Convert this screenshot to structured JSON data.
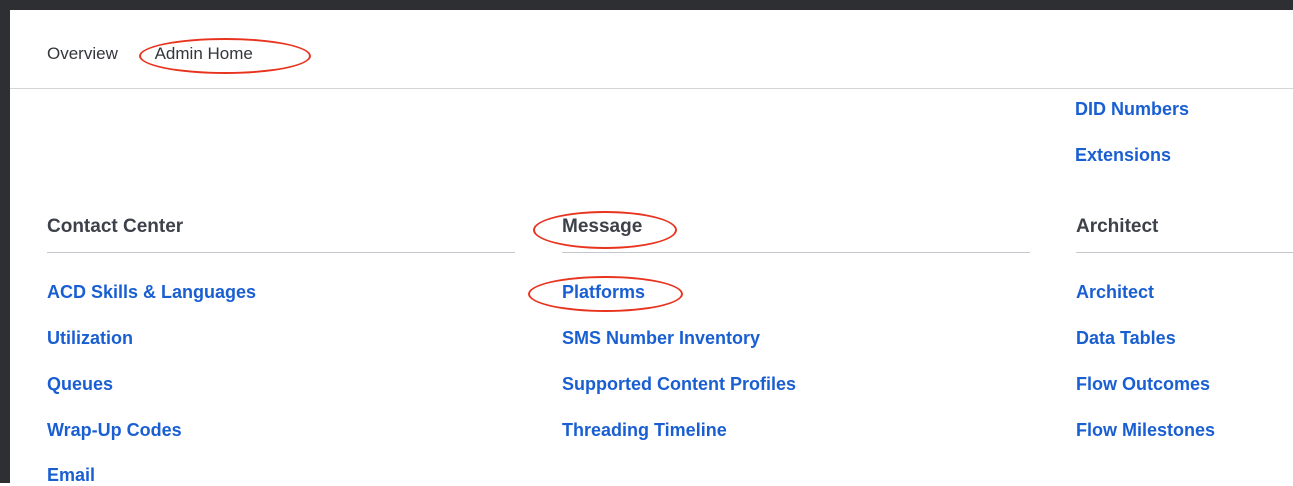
{
  "breadcrumb": {
    "items": [
      "Overview",
      "Admin Home"
    ]
  },
  "top_links": [
    "DID Numbers",
    "Extensions"
  ],
  "sections": [
    {
      "title": "Contact Center",
      "links": [
        "ACD Skills & Languages",
        "Utilization",
        "Queues",
        "Wrap-Up Codes",
        "Email"
      ]
    },
    {
      "title": "Message",
      "links": [
        "Platforms",
        "SMS Number Inventory",
        "Supported Content Profiles",
        "Threading Timeline"
      ]
    },
    {
      "title": "Architect",
      "links": [
        "Architect",
        "Data Tables",
        "Flow Outcomes",
        "Flow Milestones"
      ]
    }
  ],
  "colors": {
    "link": "#1a5fd2",
    "annotation": "#e8341f",
    "heading": "#3d4149",
    "frame": "#2d2f33"
  }
}
